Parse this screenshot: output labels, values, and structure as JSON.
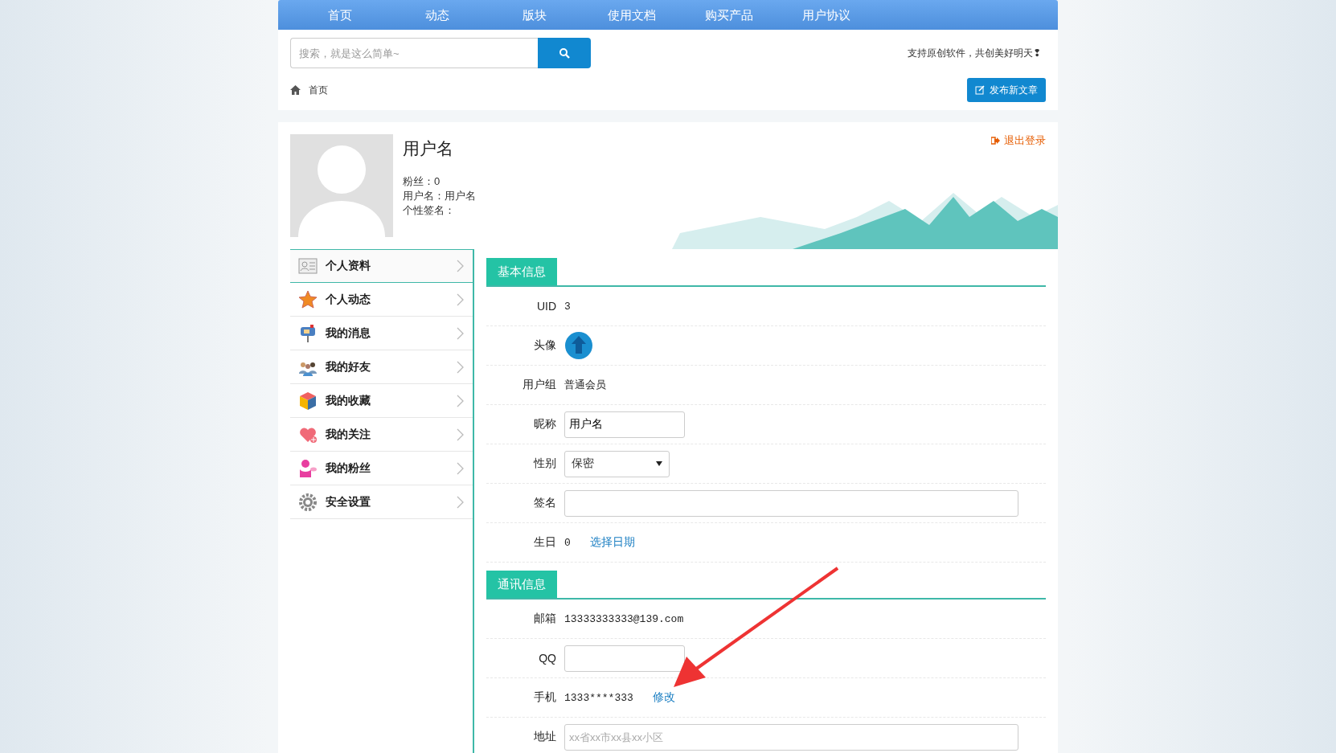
{
  "nav": [
    {
      "label": "首页"
    },
    {
      "label": "动态"
    },
    {
      "label": "版块"
    },
    {
      "label": "使用文档"
    },
    {
      "label": "购买产品"
    },
    {
      "label": "用户协议"
    }
  ],
  "search": {
    "placeholder": "搜索，就是这么简单~"
  },
  "slogan": "支持原创软件，共创美好明天❢",
  "breadcrumb": "首页",
  "post_button": "发布新文章",
  "profile": {
    "name": "用户名",
    "lines": [
      "粉丝：0",
      "用户名：用户名",
      "个性签名："
    ],
    "logout": "退出登录"
  },
  "sidebar": {
    "items": [
      {
        "label": "个人资料",
        "selected": true
      },
      {
        "label": "个人动态",
        "selected": false
      },
      {
        "label": "我的消息",
        "selected": false
      },
      {
        "label": "我的好友",
        "selected": false
      },
      {
        "label": "我的收藏",
        "selected": false
      },
      {
        "label": "我的关注",
        "selected": false
      },
      {
        "label": "我的粉丝",
        "selected": false
      },
      {
        "label": "安全设置",
        "selected": false
      }
    ]
  },
  "sections": [
    {
      "title": "基本信息",
      "rows": [
        {
          "kind": "text",
          "label": "UID",
          "value": "3"
        },
        {
          "kind": "avatar",
          "label": "头像"
        },
        {
          "kind": "text",
          "label": "用户组",
          "value": "普通会员"
        },
        {
          "kind": "input",
          "label": "昵称",
          "value": "用户名"
        },
        {
          "kind": "select",
          "label": "性别",
          "value": "保密"
        },
        {
          "kind": "wide_input",
          "label": "签名"
        },
        {
          "kind": "link",
          "label": "生日",
          "value": "0",
          "link": "选择日期"
        }
      ]
    },
    {
      "title": "通讯信息",
      "rows": [
        {
          "kind": "text",
          "label": "邮箱",
          "value": "13333333333@139.com"
        },
        {
          "kind": "input",
          "label": "QQ"
        },
        {
          "kind": "link",
          "label": "手机",
          "value": "1333****333",
          "link": "修改"
        },
        {
          "kind": "wide_input",
          "label": "地址",
          "placeholder": "xx省xx市xx县xx小区"
        }
      ]
    }
  ]
}
